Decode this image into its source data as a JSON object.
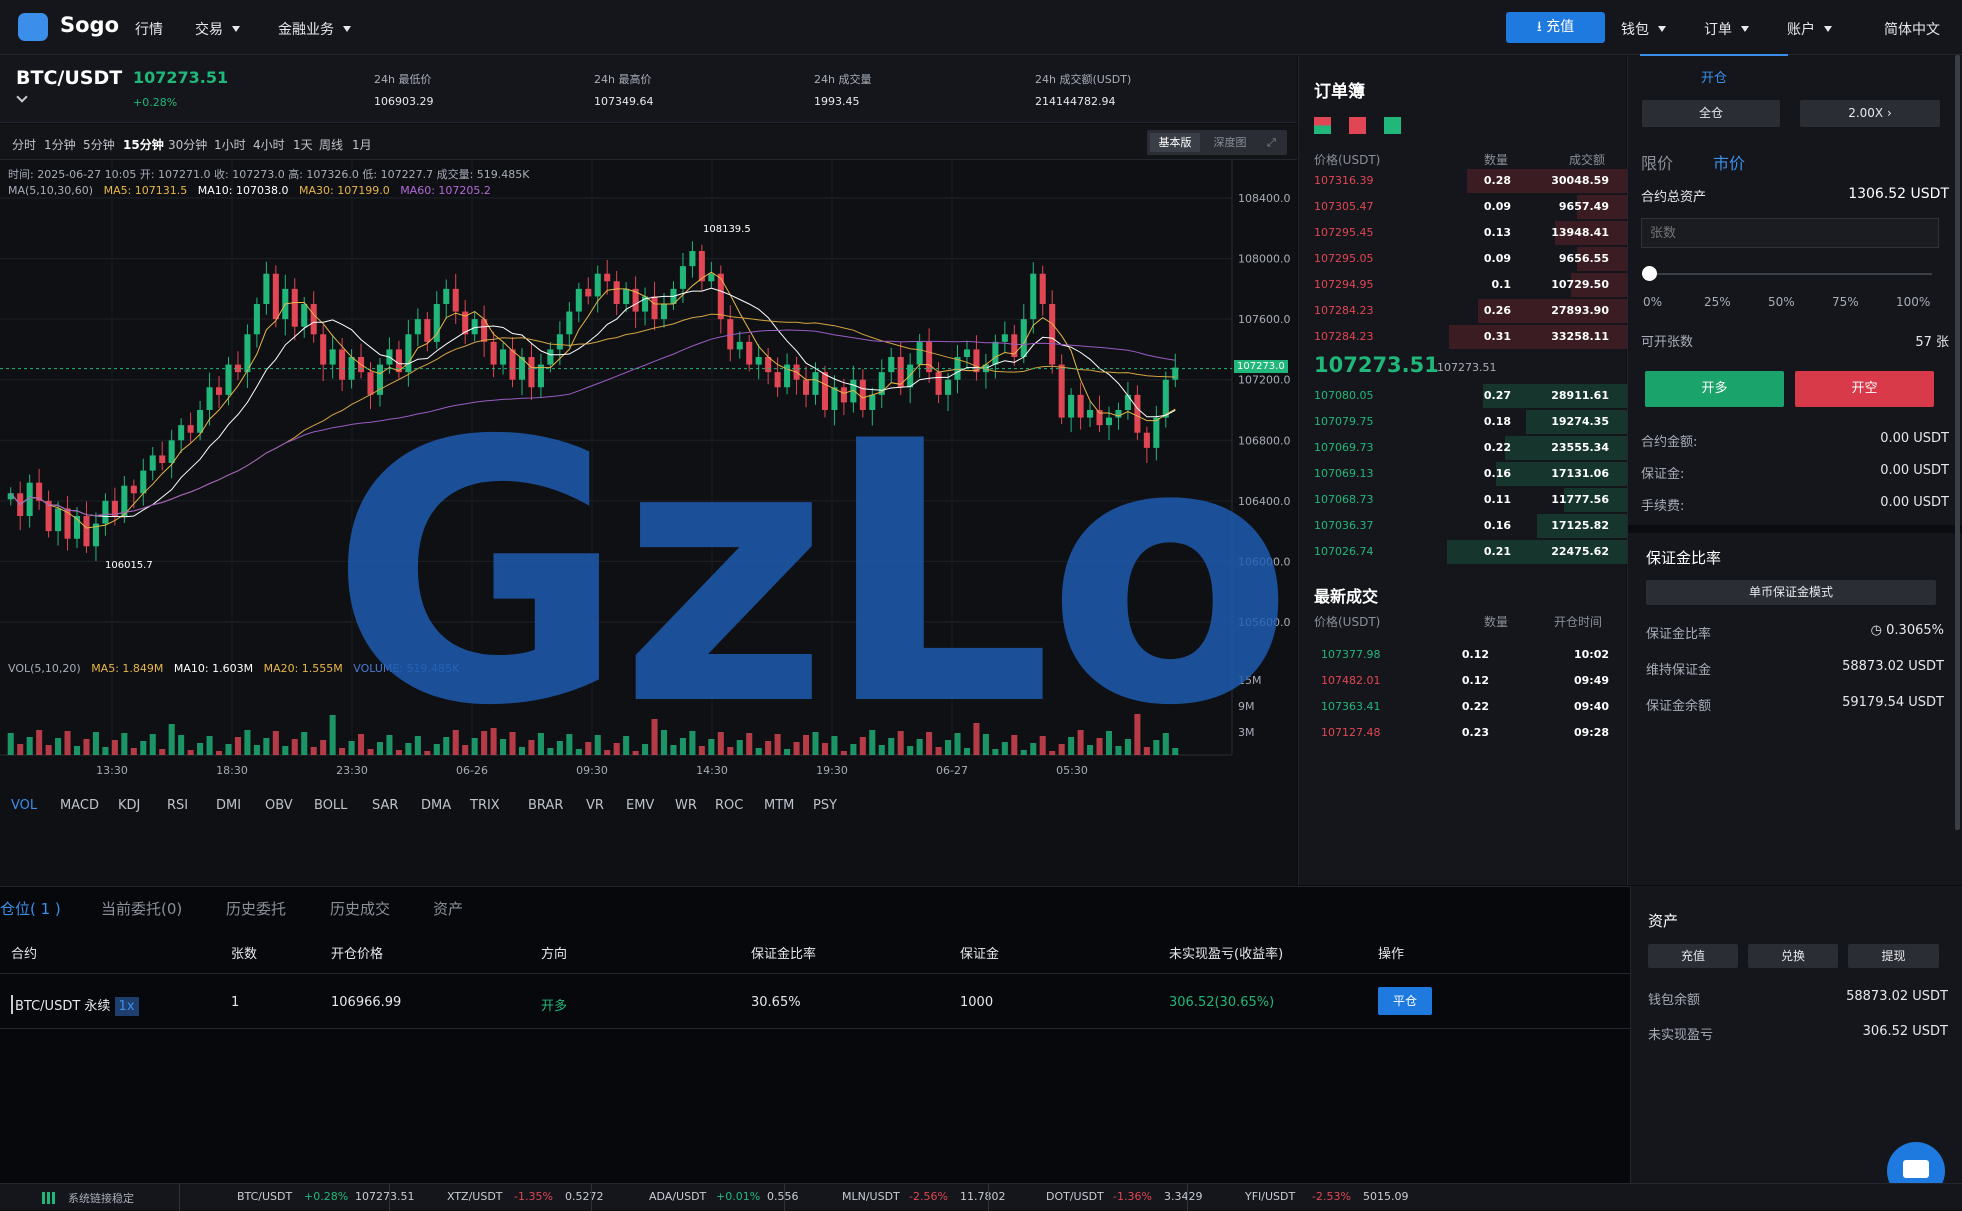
{
  "app": {
    "name": "Sogo",
    "language": "简体中文"
  },
  "nav": {
    "items": [
      "行情",
      "交易",
      "金融业务"
    ],
    "recharge": "充值",
    "right": [
      "钱包",
      "订单",
      "账户"
    ]
  },
  "ticker": {
    "symbol": "BTC/USDT",
    "price": "107273.51",
    "change": "+0.28%",
    "stats": [
      {
        "label": "24h 最低价",
        "value": "106903.29"
      },
      {
        "label": "24h 最高价",
        "value": "107349.64"
      },
      {
        "label": "24h 成交量",
        "value": "1993.45"
      },
      {
        "label": "24h 成交额(USDT)",
        "value": "214144782.94"
      }
    ]
  },
  "timeframes": [
    "分时",
    "1分钟",
    "5分钟",
    "15分钟",
    "30分钟",
    "1小时",
    "4小时",
    "1天",
    "周线",
    "1月"
  ],
  "active_timeframe": "15分钟",
  "chart_modes": [
    "基本版",
    "深度图"
  ],
  "chart_info": {
    "ohlc": "时间: 2025-06-27 10:05   开: 107271.0   收: 107273.0   高: 107326.0   低: 107227.7   成交量: 519.485K",
    "ma_label": "MA(5,10,30,60)",
    "ma5": "MA5: 107131.5",
    "ma10": "MA10: 107038.0",
    "ma30": "MA30: 107199.0",
    "ma60": "MA60: 107205.2",
    "vol_label": "VOL(5,10,20)",
    "vma5": "MA5: 1.849M",
    "vma10": "MA10: 1.603M",
    "vma20": "MA20: 1.555M",
    "volume": "VOLUME: 519.485K",
    "high_mark": "108139.5",
    "low_mark": "106015.7",
    "current_tag": "107273.0"
  },
  "chart_data": {
    "type": "candlestick",
    "y_ticks": [
      "108400.0",
      "108000.0",
      "107600.0",
      "107200.0",
      "106800.0",
      "106400.0",
      "106000.0",
      "105600.0"
    ],
    "vol_ticks": [
      "15M",
      "9M",
      "3M"
    ],
    "x_ticks": [
      "13:30",
      "18:30",
      "23:30",
      "06-26",
      "09:30",
      "14:30",
      "19:30",
      "06-27",
      "05:30"
    ],
    "ylim": [
      105600,
      108400
    ],
    "close": [
      106450,
      106300,
      106520,
      106400,
      106200,
      106350,
      106150,
      106300,
      106100,
      106250,
      106400,
      106300,
      106500,
      106450,
      106600,
      106700,
      106650,
      106800,
      106900,
      106850,
      107000,
      107150,
      107100,
      107300,
      107250,
      107500,
      107700,
      107900,
      107600,
      107800,
      107550,
      107700,
      107500,
      107300,
      107400,
      107200,
      107350,
      107250,
      107100,
      107300,
      107400,
      107250,
      107500,
      107600,
      107450,
      107700,
      107800,
      107650,
      107500,
      107600,
      107450,
      107300,
      107400,
      107200,
      107350,
      107150,
      107300,
      107400,
      107500,
      107650,
      107800,
      107750,
      107900,
      107850,
      107700,
      107800,
      107650,
      107750,
      107600,
      107700,
      107800,
      107950,
      108050,
      107850,
      107900,
      107600,
      107400,
      107450,
      107300,
      107350,
      107250,
      107150,
      107300,
      107200,
      107100,
      107250,
      107000,
      107150,
      107050,
      107200,
      107000,
      107100,
      107250,
      107350,
      107150,
      107300,
      107450,
      107250,
      107100,
      107200,
      107350,
      107400,
      107250,
      107300,
      107450,
      107500,
      107350,
      107600,
      107900,
      107700,
      107300,
      106950,
      107100,
      106950,
      107000,
      106900,
      106950,
      107000,
      107100,
      106850,
      106750,
      106950,
      107200,
      107280
    ],
    "series": [
      {
        "name": "MA5"
      },
      {
        "name": "MA10"
      },
      {
        "name": "MA30"
      },
      {
        "name": "MA60"
      }
    ]
  },
  "indicators": [
    "VOL",
    "MACD",
    "KDJ",
    "RSI",
    "DMI",
    "OBV",
    "BOLL",
    "SAR",
    "DMA",
    "TRIX",
    "BRAR",
    "VR",
    "EMV",
    "WR",
    "ROC",
    "MTM",
    "PSY"
  ],
  "orderbook": {
    "title": "订单簿",
    "headers": [
      "价格(USDT)",
      "数量",
      "成交额"
    ],
    "asks": [
      {
        "price": "107316.39",
        "qty": "0.28",
        "total": "30048.59",
        "depth": 0.89
      },
      {
        "price": "107305.47",
        "qty": "0.09",
        "total": "9657.49",
        "depth": 0.28
      },
      {
        "price": "107295.45",
        "qty": "0.13",
        "total": "13948.41",
        "depth": 0.4
      },
      {
        "price": "107295.05",
        "qty": "0.09",
        "total": "9656.55",
        "depth": 0.28
      },
      {
        "price": "107294.95",
        "qty": "0.1",
        "total": "10729.50",
        "depth": 0.31
      },
      {
        "price": "107284.23",
        "qty": "0.26",
        "total": "27893.90",
        "depth": 0.83
      },
      {
        "price": "107284.23",
        "qty": "0.31",
        "total": "33258.11",
        "depth": 0.99
      }
    ],
    "mid": "107273.51",
    "mid_small": "107273.51",
    "bids": [
      {
        "price": "107080.05",
        "qty": "0.27",
        "total": "28911.61",
        "depth": 0.8
      },
      {
        "price": "107079.75",
        "qty": "0.18",
        "total": "19274.35",
        "depth": 0.56
      },
      {
        "price": "107069.73",
        "qty": "0.22",
        "total": "23555.34",
        "depth": 0.68
      },
      {
        "price": "107069.13",
        "qty": "0.16",
        "total": "17131.06",
        "depth": 0.73
      },
      {
        "price": "107068.73",
        "qty": "0.11",
        "total": "11777.56",
        "depth": 0.35
      },
      {
        "price": "107036.37",
        "qty": "0.16",
        "total": "17125.82",
        "depth": 0.5
      },
      {
        "price": "107026.74",
        "qty": "0.21",
        "total": "22475.62",
        "depth": 1.0
      }
    ]
  },
  "trades": {
    "title": "最新成交",
    "headers": [
      "价格(USDT)",
      "数量",
      "开仓时间"
    ],
    "rows": [
      {
        "price": "107377.98",
        "qty": "0.12",
        "time": "10:02",
        "side": "buy"
      },
      {
        "price": "107482.01",
        "qty": "0.12",
        "time": "09:49",
        "side": "sell"
      },
      {
        "price": "107363.41",
        "qty": "0.22",
        "time": "09:40",
        "side": "buy"
      },
      {
        "price": "107127.48",
        "qty": "0.23",
        "time": "09:28",
        "side": "sell"
      }
    ]
  },
  "trade_panel": {
    "tabs": [
      "开仓"
    ],
    "margin_mode": "全仓",
    "leverage": "2.00X",
    "order_types": [
      "限价",
      "市价"
    ],
    "total_assets_label": "合约总资产",
    "total_assets": "1306.52 USDT",
    "qty_placeholder": "张数",
    "slider_marks": [
      "0%",
      "25%",
      "50%",
      "75%",
      "100%"
    ],
    "slider_value": 0,
    "openable_label": "可开张数",
    "openable": "57 张",
    "buy_label": "开多",
    "sell_label": "开空",
    "summary": [
      {
        "label": "合约金额:",
        "value": "0.00 USDT"
      },
      {
        "label": "保证金:",
        "value": "0.00 USDT"
      },
      {
        "label": "手续费:",
        "value": "0.00 USDT"
      }
    ],
    "margin_title": "保证金比率",
    "margin_mode_btn": "单币保证金模式",
    "margin_rows": [
      {
        "label": "保证金比率",
        "value": "0.3065%"
      },
      {
        "label": "维持保证金",
        "value": "58873.02 USDT"
      },
      {
        "label": "保证金余额",
        "value": "59179.54 USDT"
      }
    ]
  },
  "positions": {
    "tabs": [
      "仓位( 1 )",
      "当前委托(0)",
      "历史委托",
      "历史成交",
      "资产"
    ],
    "headers": [
      "合约",
      "张数",
      "开仓价格",
      "方向",
      "保证金比率",
      "保证金",
      "未实现盈亏(收益率)",
      "操作"
    ],
    "row": {
      "contract": "BTC/USDT 永续",
      "lev": "1x",
      "qty": "1",
      "open_price": "106966.99",
      "side": "开多",
      "margin_ratio": "30.65%",
      "margin": "1000",
      "pnl": "306.52(30.65%)",
      "action": "平仓"
    }
  },
  "assets": {
    "title": "资产",
    "buttons": [
      "充值",
      "兑换",
      "提现"
    ],
    "rows": [
      {
        "label": "钱包余额",
        "value": "58873.02 USDT"
      },
      {
        "label": "未实现盈亏",
        "value": "306.52 USDT"
      }
    ]
  },
  "footer": {
    "status": "系统链接稳定",
    "tickers": [
      {
        "sym": "BTC/USDT",
        "chg": "+0.28%",
        "price": "107273.51",
        "up": true
      },
      {
        "sym": "XTZ/USDT",
        "chg": "-1.35%",
        "price": "0.5272",
        "up": false
      },
      {
        "sym": "ADA/USDT",
        "chg": "+0.01%",
        "price": "0.556",
        "up": true
      },
      {
        "sym": "MLN/USDT",
        "chg": "-2.56%",
        "price": "11.7802",
        "up": false
      },
      {
        "sym": "DOT/USDT",
        "chg": "-1.36%",
        "price": "3.3429",
        "up": false
      },
      {
        "sym": "YFI/USDT",
        "chg": "-2.53%",
        "price": "5015.09",
        "up": false
      }
    ]
  },
  "watermark": "GzLoG",
  "colors": {
    "up": "#21b77a",
    "down": "#e04653",
    "accent": "#1f7ae0"
  }
}
